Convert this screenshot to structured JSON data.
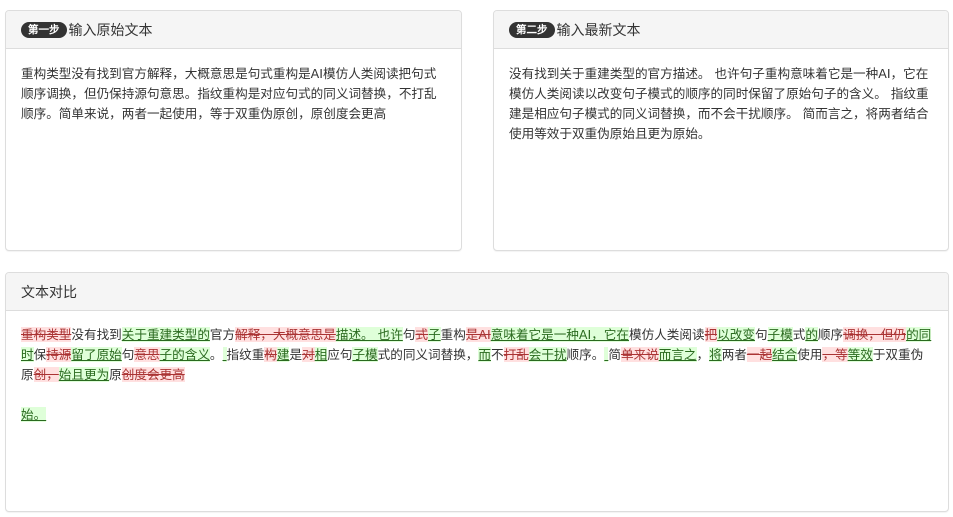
{
  "step1": {
    "badge": "第一步",
    "title": "输入原始文本",
    "text": "重构类型没有找到官方解释，大概意思是句式重构是AI模仿人类阅读把句式顺序调换，但仍保持源句意思。指纹重构是对应句式的同义词替换，不打乱顺序。简单来说，两者一起使用，等于双重伪原创，原创度会更高"
  },
  "step2": {
    "badge": "第二步",
    "title": "输入最新文本",
    "text": "没有找到关于重建类型的官方描述。 也许句子重构意味着它是一种AI，它在模仿人类阅读以改变句子模式的顺序的同时保留了原始句子的含义。 指纹重建是相应句子模式的同义词替换，而不会干扰顺序。 简而言之，将两者结合使用等效于双重伪原始且更为原始。"
  },
  "compare": {
    "title": "文本对比",
    "segments": [
      {
        "t": "del",
        "s": "重构类型"
      },
      {
        "t": "eq",
        "s": "没有找到"
      },
      {
        "t": "ins",
        "s": "关于重建类型的"
      },
      {
        "t": "eq",
        "s": "官方"
      },
      {
        "t": "del",
        "s": "解释，大概意思是"
      },
      {
        "t": "ins",
        "s": "描述。 也许"
      },
      {
        "t": "eq",
        "s": "句"
      },
      {
        "t": "del",
        "s": "式"
      },
      {
        "t": "ins",
        "s": "子"
      },
      {
        "t": "eq",
        "s": "重构"
      },
      {
        "t": "del",
        "s": "是AI"
      },
      {
        "t": "ins",
        "s": "意味着它是一种AI，它在"
      },
      {
        "t": "eq",
        "s": "模仿人类阅读"
      },
      {
        "t": "del",
        "s": "把"
      },
      {
        "t": "ins",
        "s": "以改变"
      },
      {
        "t": "eq",
        "s": "句"
      },
      {
        "t": "ins",
        "s": "子模"
      },
      {
        "t": "eq",
        "s": "式"
      },
      {
        "t": "ins",
        "s": "的"
      },
      {
        "t": "eq",
        "s": "顺序"
      },
      {
        "t": "del",
        "s": "调换，但仍"
      },
      {
        "t": "ins",
        "s": "的同时"
      },
      {
        "t": "eq",
        "s": "保"
      },
      {
        "t": "del",
        "s": "持源"
      },
      {
        "t": "ins",
        "s": "留了原始"
      },
      {
        "t": "eq",
        "s": "句"
      },
      {
        "t": "del",
        "s": "意思"
      },
      {
        "t": "ins",
        "s": "子的含义"
      },
      {
        "t": "eq",
        "s": "。"
      },
      {
        "t": "ins",
        "s": " "
      },
      {
        "t": "eq",
        "s": "指纹重"
      },
      {
        "t": "del",
        "s": "构"
      },
      {
        "t": "ins",
        "s": "建"
      },
      {
        "t": "eq",
        "s": "是"
      },
      {
        "t": "del",
        "s": "对"
      },
      {
        "t": "ins",
        "s": "相"
      },
      {
        "t": "eq",
        "s": "应句"
      },
      {
        "t": "ins",
        "s": "子模"
      },
      {
        "t": "eq",
        "s": "式的同义词替换，"
      },
      {
        "t": "ins",
        "s": "而"
      },
      {
        "t": "eq",
        "s": "不"
      },
      {
        "t": "del",
        "s": "打乱"
      },
      {
        "t": "ins",
        "s": "会干扰"
      },
      {
        "t": "eq",
        "s": "顺序。"
      },
      {
        "t": "ins",
        "s": " "
      },
      {
        "t": "eq",
        "s": "简"
      },
      {
        "t": "del",
        "s": "单来说"
      },
      {
        "t": "ins",
        "s": "而言之"
      },
      {
        "t": "eq",
        "s": "，"
      },
      {
        "t": "ins",
        "s": "将"
      },
      {
        "t": "eq",
        "s": "两者"
      },
      {
        "t": "del",
        "s": "一起"
      },
      {
        "t": "ins",
        "s": "结合"
      },
      {
        "t": "eq",
        "s": "使用"
      },
      {
        "t": "del",
        "s": "，等"
      },
      {
        "t": "ins",
        "s": "等效"
      },
      {
        "t": "eq",
        "s": "于双重伪原"
      },
      {
        "t": "del",
        "s": "创，"
      },
      {
        "t": "ins",
        "s": "始且更为"
      },
      {
        "t": "eq",
        "s": "原"
      },
      {
        "t": "del",
        "s": "创度会更高"
      }
    ],
    "tail": "始。"
  },
  "colors": {
    "deleted_bg": "#ffe0e0",
    "inserted_bg": "#dfffd9",
    "heading_bg": "#f5f5f5",
    "badge_bg": "#333333"
  }
}
